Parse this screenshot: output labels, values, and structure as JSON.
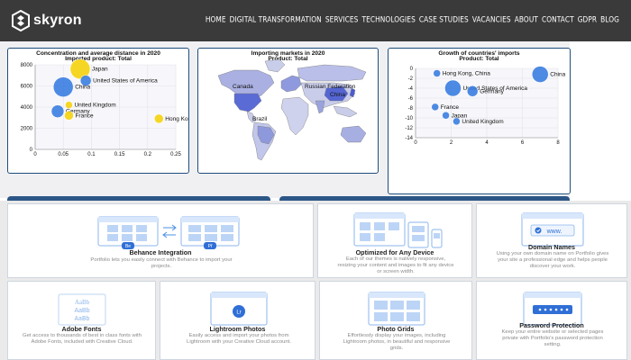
{
  "brand": {
    "name": "skyron"
  },
  "nav": [
    "HOME",
    "DIGITAL TRANSFORMATION",
    "SERVICES",
    "TECHNOLOGIES",
    "CASE STUDIES",
    "VACANCIES",
    "ABOUT",
    "CONTACT",
    "GDPR",
    "BLOG"
  ],
  "panels": {
    "concentration": {
      "title": "Concentration and average distance in 2020",
      "subtitle": "Imported product: Total"
    },
    "markets": {
      "title": "Importing markets in 2020",
      "subtitle": "Product: Total",
      "map_labels": [
        "Canada",
        "Russian Federation",
        "China",
        "Brazil"
      ]
    },
    "growth": {
      "title": "Growth of countries' imports",
      "subtitle": "Product: Total"
    }
  },
  "chart_data": [
    {
      "type": "scatter",
      "title": "Concentration and average distance in 2020",
      "subtitle": "Imported product: Total",
      "xlim": [
        0,
        0.25
      ],
      "ylim": [
        0,
        8000
      ],
      "x_ticks": [
        "0",
        "0.05",
        "0.1",
        "0.15",
        "0.2",
        "0.25"
      ],
      "y_ticks": [
        "0",
        "2000",
        "4000",
        "6000",
        "8000"
      ],
      "points": [
        {
          "label": "Japan",
          "x": 0.08,
          "y": 7600,
          "size": 11,
          "color": "#f5d20c"
        },
        {
          "label": "United States of America",
          "x": 0.09,
          "y": 6500,
          "size": 6,
          "color": "#3a7de0"
        },
        {
          "label": "China",
          "x": 0.05,
          "y": 5900,
          "size": 11,
          "color": "#3a7de0"
        },
        {
          "label": "United Kingdom",
          "x": 0.06,
          "y": 4200,
          "size": 4,
          "color": "#f5d20c"
        },
        {
          "label": "Germany",
          "x": 0.04,
          "y": 3600,
          "size": 7,
          "color": "#3a7de0"
        },
        {
          "label": "France",
          "x": 0.06,
          "y": 3200,
          "size": 5,
          "color": "#f5d20c"
        },
        {
          "label": "Hong Kong, China",
          "x": 0.22,
          "y": 2900,
          "size": 5,
          "color": "#f5d20c"
        }
      ]
    },
    {
      "type": "scatter",
      "title": "Growth of countries' imports",
      "subtitle": "Product: Total",
      "xlim": [
        0,
        8
      ],
      "ylim": [
        -14,
        0
      ],
      "x_ticks": [
        "0",
        "2",
        "4",
        "6",
        "8"
      ],
      "y_ticks": [
        "0",
        "-2",
        "-4",
        "-6",
        "-8",
        "-10",
        "-12",
        "-14"
      ],
      "points": [
        {
          "label": "Hong Kong, China",
          "x": 1.2,
          "y": -1.0,
          "size": 4,
          "color": "#3a7de0"
        },
        {
          "label": "China",
          "x": 7.0,
          "y": -1.2,
          "size": 9,
          "color": "#3a7de0"
        },
        {
          "label": "United States of America",
          "x": 2.1,
          "y": -4.0,
          "size": 9,
          "color": "#3a7de0"
        },
        {
          "label": "Germany",
          "x": 3.2,
          "y": -4.6,
          "size": 6,
          "color": "#3a7de0"
        },
        {
          "label": "France",
          "x": 1.1,
          "y": -7.8,
          "size": 4,
          "color": "#3a7de0"
        },
        {
          "label": "Japan",
          "x": 1.7,
          "y": -9.5,
          "size": 4,
          "color": "#3a7de0"
        },
        {
          "label": "United Kingdom",
          "x": 2.3,
          "y": -10.7,
          "size": 4,
          "color": "#3a7de0"
        }
      ]
    }
  ],
  "cards": [
    {
      "title": "Behance Integration",
      "desc": "Portfolio lets you easily connect with Behance to import your projects.",
      "badges": [
        "Be",
        "Pf"
      ]
    },
    {
      "title": "Optimized for Any Device",
      "desc": "Each of our themes is natively responsive, resizing your content and images to fit any device or screen width."
    },
    {
      "title": "Domain Names",
      "desc": "Using your own domain name on Portfolio gives your site a professional edge and helps people discover your work.",
      "badge": "www."
    },
    {
      "title": "Adobe Fonts",
      "desc": "Get access to thousands of best in class fonts with Adobe Fonts, included with Creative Cloud.",
      "sample": "AaBb"
    },
    {
      "title": "Lightroom Photos",
      "desc": "Easily access and import your photos from Lightroom with your Creative Cloud account.",
      "badge": "Lr"
    },
    {
      "title": "Photo Grids",
      "desc": "Effortlessly display your images, including Lightroom photos, in beautiful and responsive grids."
    },
    {
      "title": "Password Protection",
      "desc": "Keep your entire website or selected pages private with Portfolio's password protection setting."
    }
  ],
  "colors": {
    "nav_bg": "#3a3a3a",
    "panel_border": "#1f4e7c",
    "bubble_blue": "#3a7de0",
    "bubble_yellow": "#f5d20c",
    "accent_blue": "#4a90e2"
  }
}
